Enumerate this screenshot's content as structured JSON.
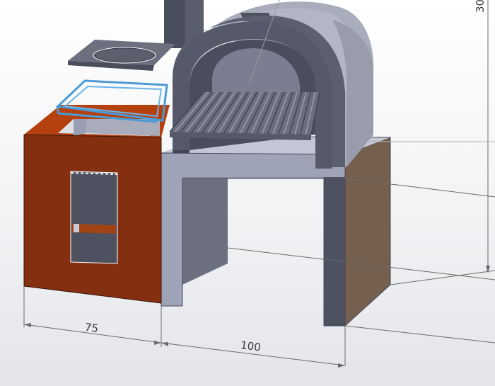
{
  "dimensions": {
    "width_left": "75",
    "width_base": "100",
    "height_right": "30"
  },
  "colors": {
    "rust": "#843010",
    "rust_orange": "#b5410f",
    "concrete_top": "#b8bccc",
    "concrete_front": "#9a9eb2",
    "concrete_dark": "#4d5160",
    "oven_light": "#a6aab8",
    "oven_dark": "#5c606e",
    "brown_side": "#75604f",
    "selection": "#4a9ad6"
  }
}
